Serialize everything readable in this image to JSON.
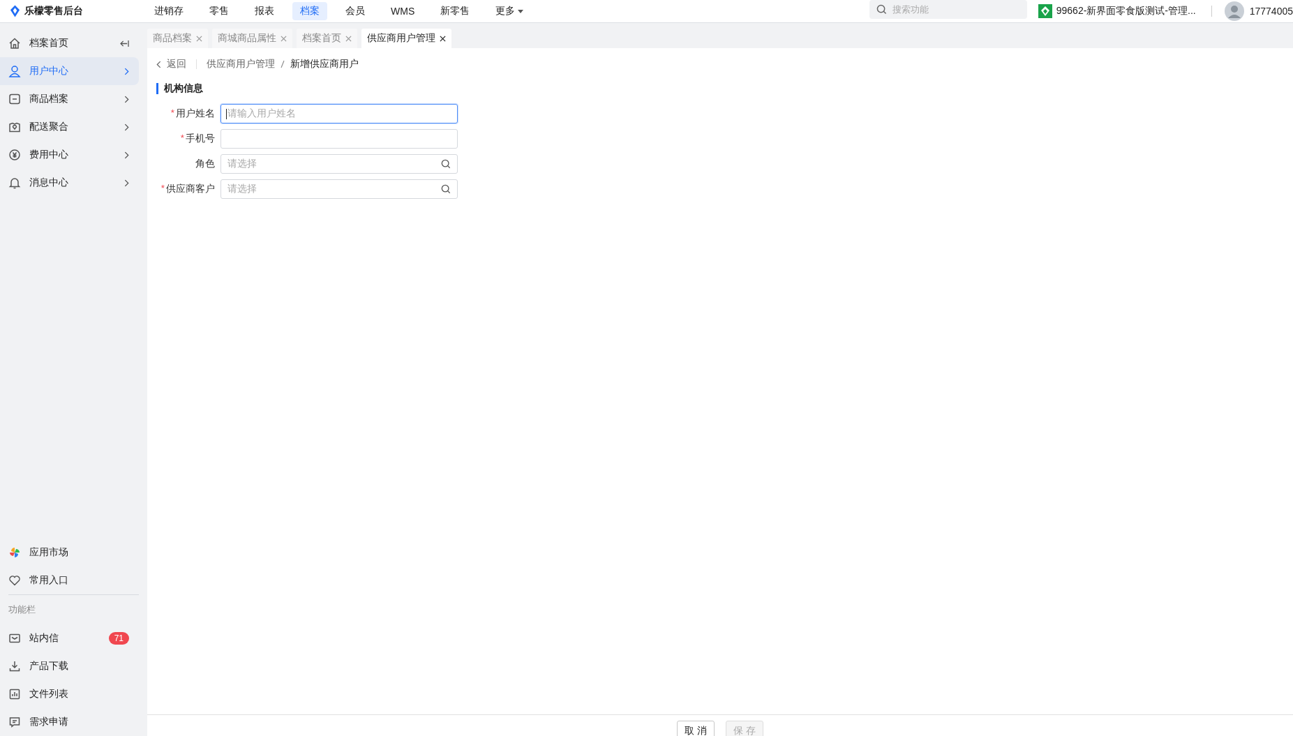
{
  "app": {
    "title": "乐檬零售后台"
  },
  "top_nav": [
    {
      "label": "进销存",
      "selected": false,
      "dropdown": false
    },
    {
      "label": "零售",
      "selected": false,
      "dropdown": false
    },
    {
      "label": "报表",
      "selected": false,
      "dropdown": false
    },
    {
      "label": "档案",
      "selected": true,
      "dropdown": false
    },
    {
      "label": "会员",
      "selected": false,
      "dropdown": false
    },
    {
      "label": "WMS",
      "selected": false,
      "dropdown": false
    },
    {
      "label": "新零售",
      "selected": false,
      "dropdown": false
    },
    {
      "label": "更多",
      "selected": false,
      "dropdown": true
    }
  ],
  "search": {
    "placeholder": "搜索功能"
  },
  "store": {
    "name": "99662-新界面零食版测试-管理..."
  },
  "user": {
    "name": "17774005"
  },
  "sidebar": {
    "items": [
      {
        "label": "档案首页",
        "selected": false,
        "kind": "collapse"
      },
      {
        "label": "用户中心",
        "selected": true,
        "kind": "submenu"
      },
      {
        "label": "商品档案",
        "selected": false,
        "kind": "submenu"
      },
      {
        "label": "配送聚合",
        "selected": false,
        "kind": "submenu"
      },
      {
        "label": "费用中心",
        "selected": false,
        "kind": "submenu"
      },
      {
        "label": "消息中心",
        "selected": false,
        "kind": "submenu"
      }
    ],
    "bottom_items": [
      {
        "label": "应用市场"
      },
      {
        "label": "常用入口"
      }
    ],
    "section_title": "功能栏",
    "tools": [
      {
        "label": "站内信",
        "badge": "71"
      },
      {
        "label": "产品下载"
      },
      {
        "label": "文件列表"
      },
      {
        "label": "需求申请"
      }
    ]
  },
  "tabs": [
    {
      "label": "商品档案",
      "selected": false
    },
    {
      "label": "商城商品属性",
      "selected": false
    },
    {
      "label": "档案首页",
      "selected": false
    },
    {
      "label": "供应商用户管理",
      "selected": true
    }
  ],
  "breadcrumb": {
    "back": "返回",
    "path": [
      "供应商用户管理",
      "新增供应商用户"
    ]
  },
  "section": {
    "title": "机构信息"
  },
  "fields": [
    {
      "label": "用户姓名",
      "marker": "*",
      "kind": "input",
      "placeholder": "请输入用户姓名",
      "focused": true
    },
    {
      "label": "手机号",
      "marker": "*",
      "kind": "input",
      "focused": false
    },
    {
      "label": "角色",
      "kind": "select",
      "placeholder": "请选择",
      "focused": false
    },
    {
      "label": "供应商客户",
      "marker": "*",
      "kind": "select",
      "placeholder": "请选择",
      "focused": false
    }
  ],
  "footer": {
    "buttons": [
      {
        "label": "取 消",
        "disabled": false
      },
      {
        "label": "保 存",
        "disabled": true
      }
    ]
  }
}
